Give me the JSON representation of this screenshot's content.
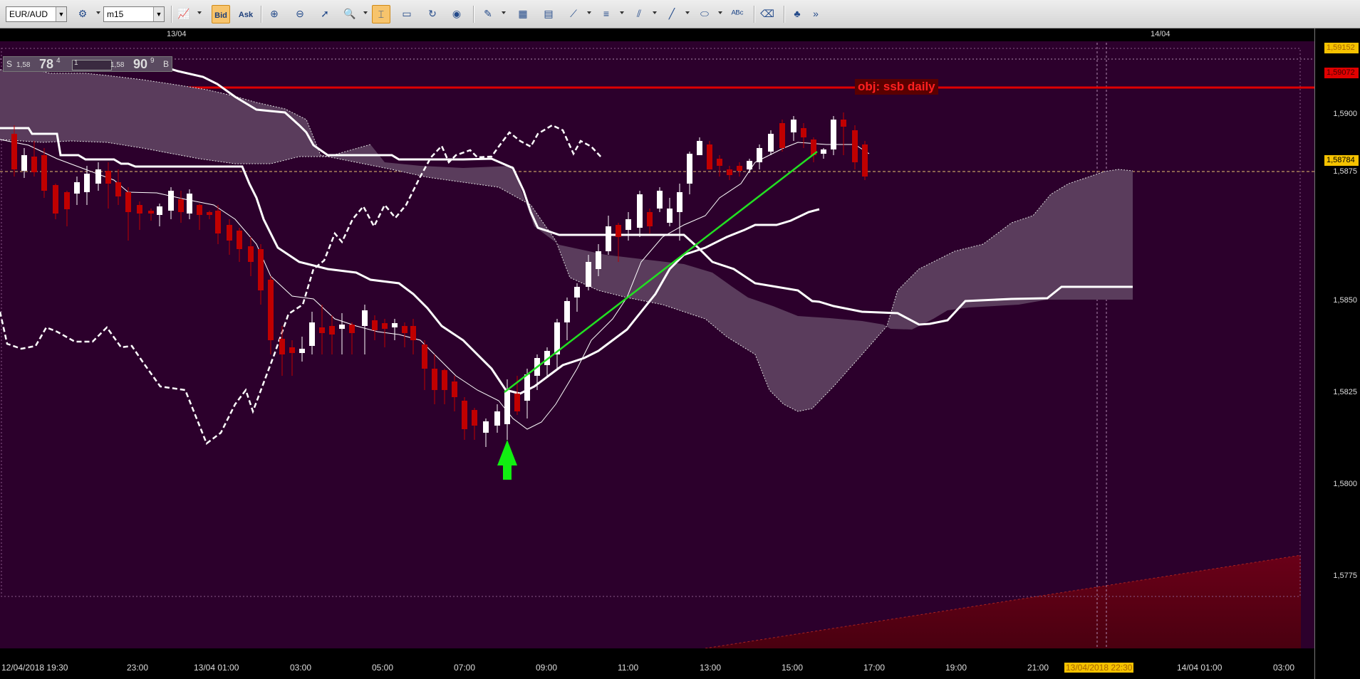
{
  "toolbar": {
    "symbol": "EUR/AUD",
    "timeframe": "m15",
    "bid_label": "Bid",
    "ask_label": "Ask"
  },
  "quote_panel": {
    "sell_label": "S",
    "sell_prefix": "1,58",
    "sell_big": "78",
    "sell_sup": "4",
    "spread": "1",
    "buy_prefix": "1,58",
    "buy_big": "90",
    "buy_sup": "9",
    "buy_label": "B"
  },
  "annotation": {
    "text": "obj: ssb daily"
  },
  "top_axis": {
    "labels": [
      "13/04",
      "14/04"
    ]
  },
  "price_axis": {
    "labels": [
      "1,5900",
      "1,5875",
      "1,5850",
      "1,5825",
      "1,5800",
      "1,5775"
    ],
    "boxes": [
      {
        "text": "1,59152",
        "bg": "#f5c200",
        "fg": "#aa6600"
      },
      {
        "text": "1,59072",
        "bg": "#e00000",
        "fg": "#440000"
      },
      {
        "text": "1,58784",
        "bg": "#f5c200",
        "fg": "#000000"
      }
    ]
  },
  "time_axis": {
    "labels": [
      "12/04/2018 19:30",
      "23:00",
      "13/04 01:00",
      "03:00",
      "05:00",
      "07:00",
      "09:00",
      "11:00",
      "13:00",
      "15:00",
      "17:00",
      "19:00",
      "21:00",
      "13/04/2018 22:30",
      "14/04 01:00",
      "03:00"
    ],
    "highlighted": "13/04/2018 22:30"
  },
  "colors": {
    "background": "#2c002c",
    "cloud": "#5a3c5c",
    "resistance": "#e00000",
    "trendline": "#22e022",
    "arrow": "#11ee11",
    "bull": "#ffffff",
    "bear": "#c00000"
  },
  "icons": [
    "instrument-icon",
    "chart-type-icon",
    "zoom-in-icon",
    "zoom-out-icon",
    "cursor-icon",
    "magnify-icon",
    "crosshair-icon",
    "window-icon",
    "refresh-icon",
    "globe-icon",
    "pencil-icon",
    "picture-icon",
    "template-icon",
    "fan-icon",
    "lines-icon",
    "channel-icon",
    "trend-line-icon",
    "ellipse-icon",
    "text-abc-icon",
    "eraser-icon",
    "tree-icon",
    "more-icon"
  ]
}
